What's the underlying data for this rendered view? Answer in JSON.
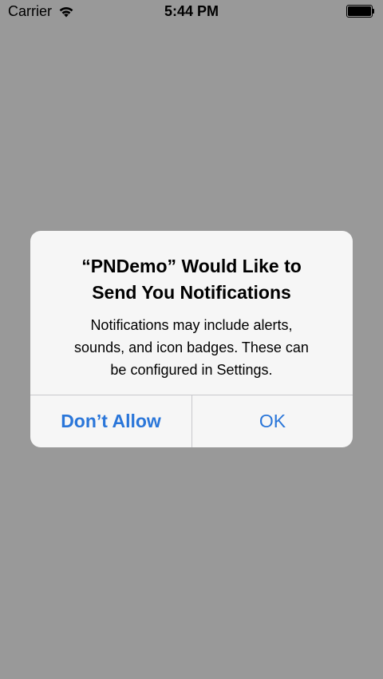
{
  "status_bar": {
    "carrier": "Carrier",
    "time": "5:44 PM",
    "wifi_icon": "wifi-icon",
    "battery_icon": "battery-icon",
    "battery_level": 1.0
  },
  "alert": {
    "title": "“PNDemo” Would Like to\nSend You Notifications",
    "message": "Notifications may include alerts,\nsounds, and icon badges. These can\nbe configured in Settings.",
    "buttons": {
      "dont_allow": "Don’t Allow",
      "ok": "OK"
    }
  },
  "colors": {
    "background": "#999999",
    "alert_background": "#f6f6f6",
    "button_text": "#2a76d9",
    "separator": "#c8c8cc"
  }
}
